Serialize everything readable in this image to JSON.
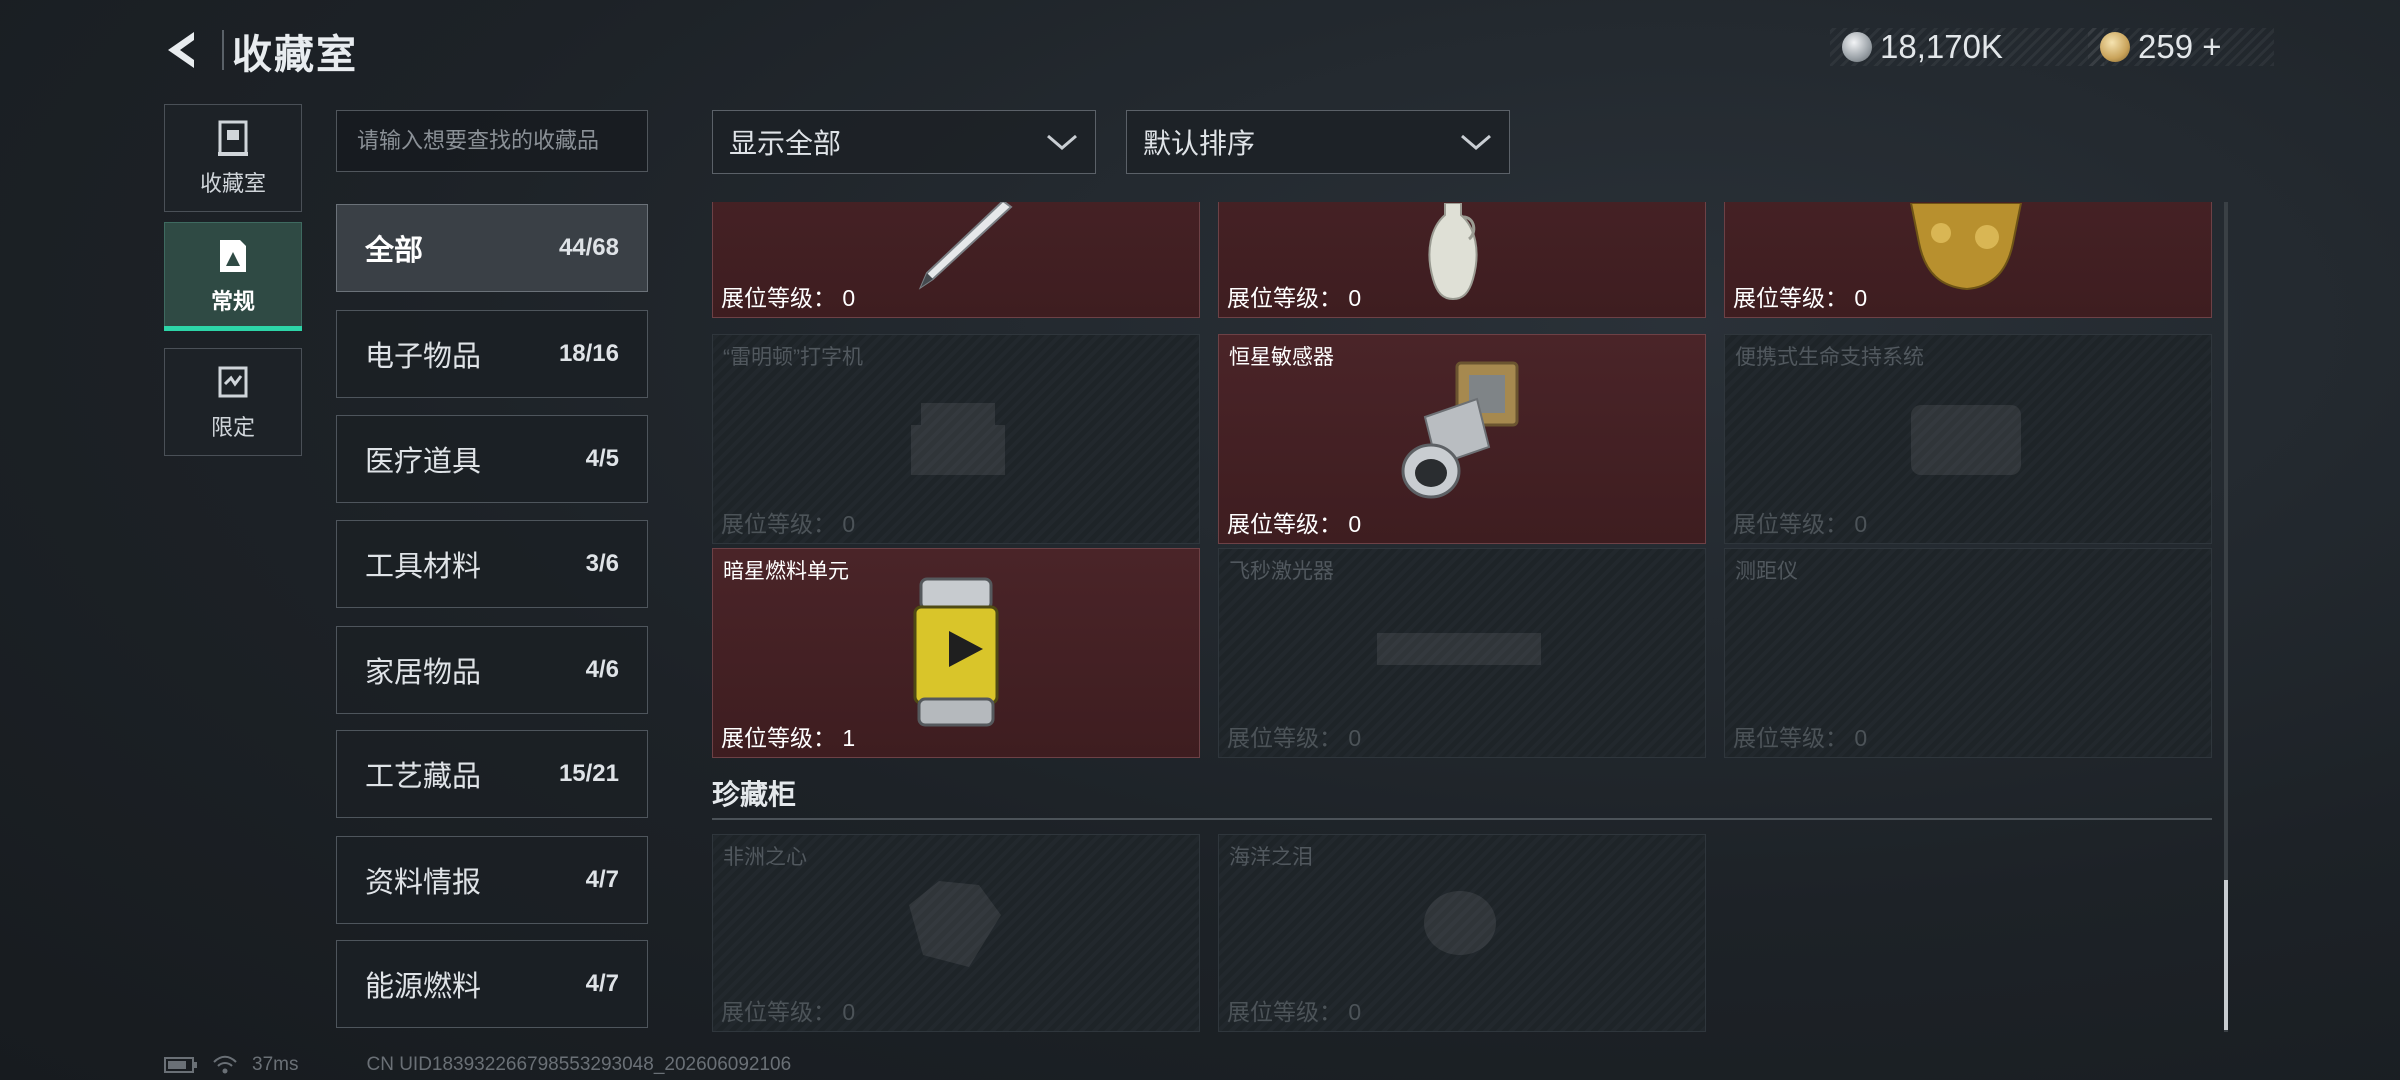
{
  "header": {
    "title": "收藏室"
  },
  "currency": [
    {
      "icon": "silver-coin-icon",
      "value": "18,170K",
      "color": "#c9ced3"
    },
    {
      "icon": "gold-coin-icon",
      "value": "259 +",
      "color": "#d8b56a"
    }
  ],
  "left_nav": [
    {
      "label": "收藏室",
      "icon": "collection-room-icon",
      "active": false
    },
    {
      "label": "常规",
      "icon": "regular-icon",
      "active": true
    },
    {
      "label": "限定",
      "icon": "limited-icon",
      "active": false
    }
  ],
  "search": {
    "placeholder": "请输入想要查找的收藏品"
  },
  "categories": [
    {
      "name": "全部",
      "count": "44/68",
      "active": true
    },
    {
      "name": "电子物品",
      "count": "18/16"
    },
    {
      "name": "医疗道具",
      "count": "4/5"
    },
    {
      "name": "工具材料",
      "count": "3/6"
    },
    {
      "name": "家居物品",
      "count": "4/6"
    },
    {
      "name": "工艺藏品",
      "count": "15/21"
    },
    {
      "name": "资料情报",
      "count": "4/7"
    },
    {
      "name": "能源燃料",
      "count": "4/7"
    }
  ],
  "filters": {
    "show": "显示全部",
    "sort": "默认排序"
  },
  "items": [
    {
      "name": "",
      "level_label": "展位等级：",
      "level": "0",
      "owned": true,
      "icon": "pen-icon"
    },
    {
      "name": "",
      "level_label": "展位等级：",
      "level": "0",
      "owned": true,
      "icon": "vase-icon"
    },
    {
      "name": "",
      "level_label": "展位等级：",
      "level": "0",
      "owned": true,
      "icon": "gold-statue-icon"
    },
    {
      "name": "“雷明顿”打字机",
      "level_label": "展位等级：",
      "level": "0",
      "owned": false,
      "icon": "typewriter-icon"
    },
    {
      "name": "恒星敏感器",
      "level_label": "展位等级：",
      "level": "0",
      "owned": true,
      "icon": "star-sensor-icon"
    },
    {
      "name": "便携式生命支持系统",
      "level_label": "展位等级：",
      "level": "0",
      "owned": false,
      "icon": "life-support-icon"
    },
    {
      "name": "暗星燃料单元",
      "level_label": "展位等级：",
      "level": "1",
      "owned": true,
      "icon": "fuel-canister-icon"
    },
    {
      "name": "飞秒激光器",
      "level_label": "展位等级：",
      "level": "0",
      "owned": false,
      "icon": "laser-icon"
    },
    {
      "name": "测距仪",
      "level_label": "展位等级：",
      "level": "0",
      "owned": false,
      "icon": "rangefinder-icon"
    }
  ],
  "treasure": {
    "title": "珍藏柜",
    "items": [
      {
        "name": "非洲之心",
        "level_label": "展位等级：",
        "level": "0",
        "owned": false,
        "icon": "diamond-icon"
      },
      {
        "name": "海洋之泪",
        "level_label": "展位等级：",
        "level": "0",
        "owned": false,
        "icon": "gem-icon"
      }
    ]
  },
  "footer": {
    "ping": "37ms",
    "uid": "CN UID183932266798553293048_202606092106"
  }
}
